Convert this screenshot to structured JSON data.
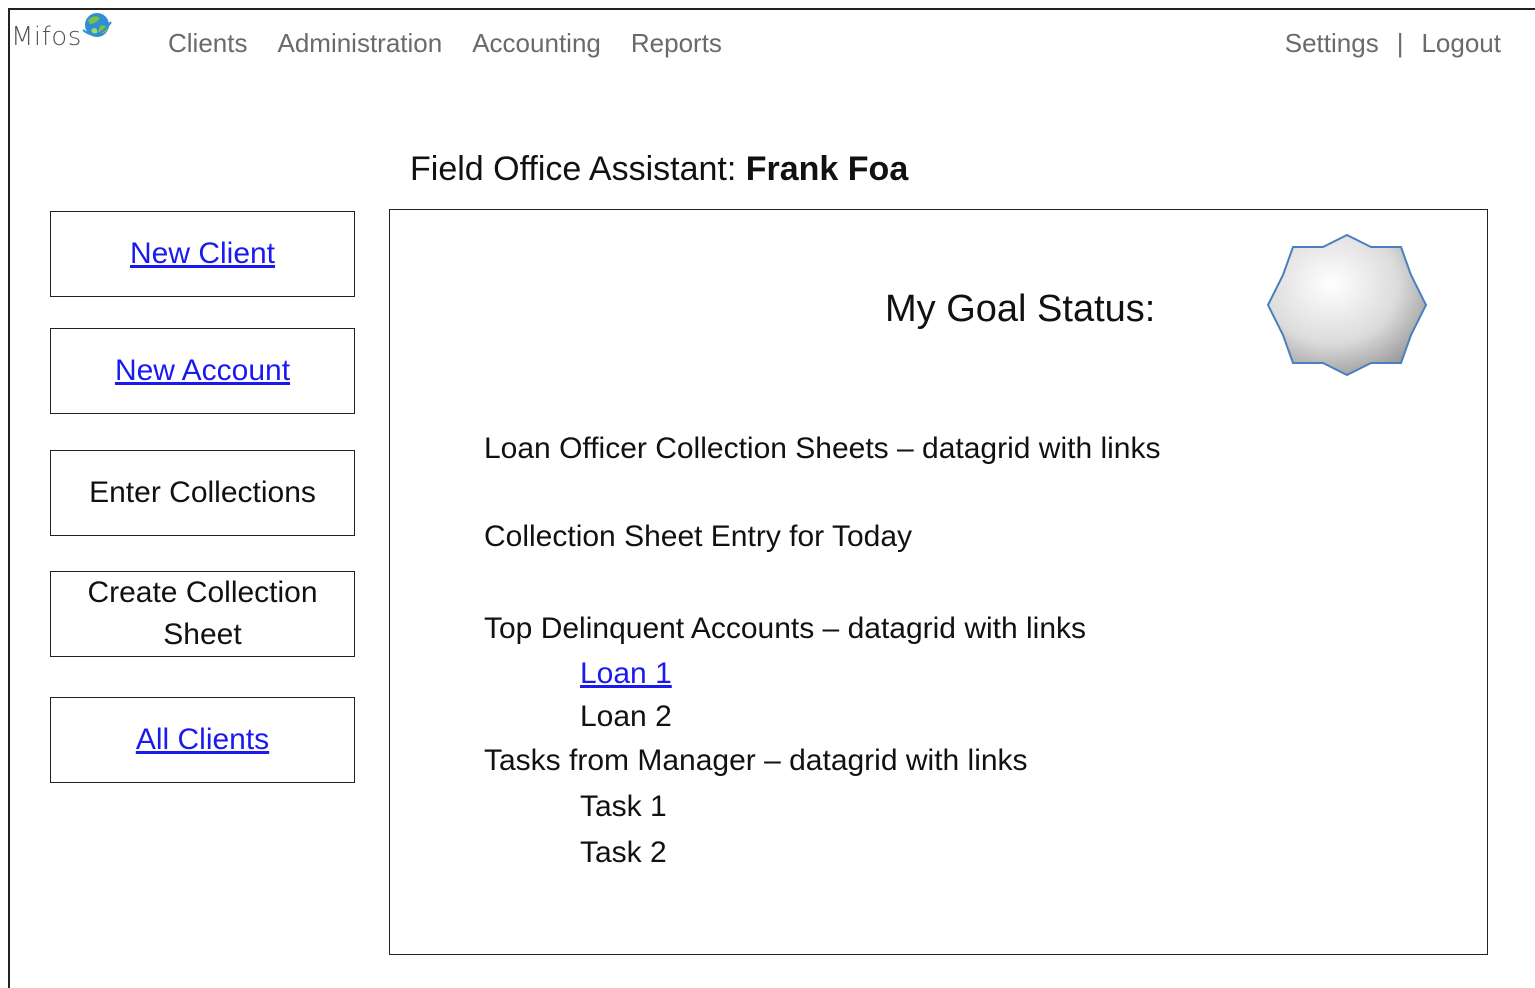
{
  "app": {
    "logo_text": "Mifos"
  },
  "nav": {
    "items": [
      "Clients",
      "Administration",
      "Accounting",
      "Reports"
    ],
    "settings": "Settings",
    "separator": "|",
    "logout": "Logout"
  },
  "page": {
    "title_prefix": "Field Office Assistant:",
    "title_name": "Frank Foa"
  },
  "sidebar": {
    "new_client": "New Client",
    "new_account": "New Account",
    "enter_collections": "Enter Collections",
    "create_collection_line1": "Create Collection",
    "create_collection_line2": "Sheet",
    "all_clients": "All Clients"
  },
  "panel": {
    "goal_status": "My Goal Status:",
    "collection_sheets": "Loan Officer Collection Sheets – datagrid with links",
    "collection_entry": "Collection Sheet Entry for Today",
    "delinquent_header": "Top Delinquent Accounts – datagrid with links",
    "loan1": "Loan 1",
    "loan2": "Loan 2",
    "tasks_header": "Tasks from Manager – datagrid with links",
    "task1": "Task 1",
    "task2": "Task 2"
  },
  "colors": {
    "link": "#1a1aee",
    "nav_text": "#6a6a6a",
    "badge_stroke": "#4a7fc1"
  },
  "icons": {
    "logo": "globe-icon",
    "badge": "star-badge-icon"
  }
}
